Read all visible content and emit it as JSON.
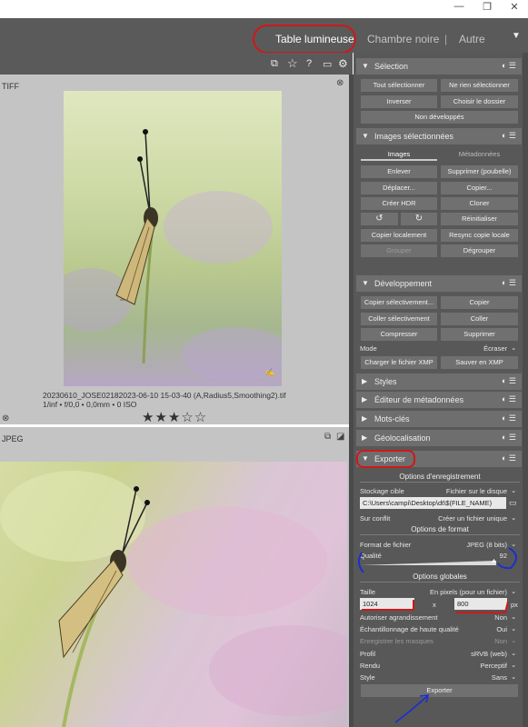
{
  "window": {
    "minimize": "—",
    "restore": "❐",
    "close": "✕"
  },
  "views": [
    {
      "label": "Table lumineuse",
      "active": true
    },
    {
      "label": "Chambre noire",
      "active": false
    },
    {
      "label": "Autre",
      "active": false
    }
  ],
  "top_separators": [
    "|",
    "|"
  ],
  "leftpanel": {
    "tiff_label": "TIFF",
    "jpeg_label": "JPEG",
    "image1_caption": "20230610_JOSE02182023-06-10 15-03-40 (A,Radius5,Smoothing2).tif",
    "image1_meta": "1/inf • f/0,0 • 0,0mm • 0 ISO",
    "image1_stars": "★★★☆☆",
    "reject_icon": "⊗"
  },
  "icons": {
    "grouping": "grouping-icon",
    "star": "star-icon",
    "help": "help-icon",
    "gear": "gear-icon"
  },
  "modules": {
    "selection": {
      "title": "Sélection",
      "buttons": [
        "Tout sélectionner",
        "Ne rien sélectionner",
        "Inverser",
        "Choisir le dossier",
        "Non développés"
      ]
    },
    "images": {
      "title": "Images sélectionnées",
      "tabs": [
        "Images",
        "Métadonnées"
      ],
      "buttons": [
        "Enlever",
        "Supprimer (poubelle)",
        "Déplacer...",
        "Copier...",
        "Créer HDR",
        "Cloner",
        "↺",
        "↻",
        "Réinitialiser",
        "Copier localement",
        "Resync copie locale",
        "Grouper",
        "Dégrouper"
      ]
    },
    "develop": {
      "title": "Développement",
      "buttons": [
        "Copier sélectivement...",
        "Copier",
        "Coller sélectivement",
        "Coller",
        "Compresser",
        "Supprimer"
      ],
      "mode_label": "Mode",
      "mode_value": "Écraser",
      "xmp_buttons": [
        "Charger le fichier XMP",
        "Sauver en XMP"
      ]
    },
    "collapsed": [
      "Styles",
      "Éditeur de métadonnées",
      "Mots-clés",
      "Géolocalisation"
    ],
    "export": {
      "title": "Exporter",
      "storage_section": "Options d'enregistrement",
      "storage_label": "Stockage cible",
      "storage_value": "Fichier sur le disque",
      "path_value": "C:\\Users\\campi\\Desktop\\dt\\$(FILE_NAME)",
      "conflict_label": "Sur conflit",
      "conflict_value": "Créer un fichier unique",
      "format_section": "Options de format",
      "format_label": "Format de fichier",
      "format_value": "JPEG (8 bits)",
      "quality_label": "Qualité",
      "quality_value": "92",
      "global_section": "Options globales",
      "size_label": "Taille",
      "size_value": "En pixels (pour un fichier)",
      "width": "1024",
      "x": "x",
      "height": "800",
      "px": "px",
      "upscale_label": "Autoriser agrandissement",
      "upscale_value": "Non",
      "hq_label": "Échantillonnage de haute qualité",
      "hq_value": "Oui",
      "masks_label": "Enregistrer les masques",
      "masks_value": "Non",
      "profile_label": "Profil",
      "profile_value": "sRVB (web)",
      "intent_label": "Rendu",
      "intent_value": "Perceptif",
      "style_label": "Style",
      "style_value": "Sans",
      "export_button": "Exporter"
    }
  },
  "colors": {
    "annotation_red": "#d01818",
    "annotation_blue": "#1a2fd0",
    "panel": "#585858"
  }
}
